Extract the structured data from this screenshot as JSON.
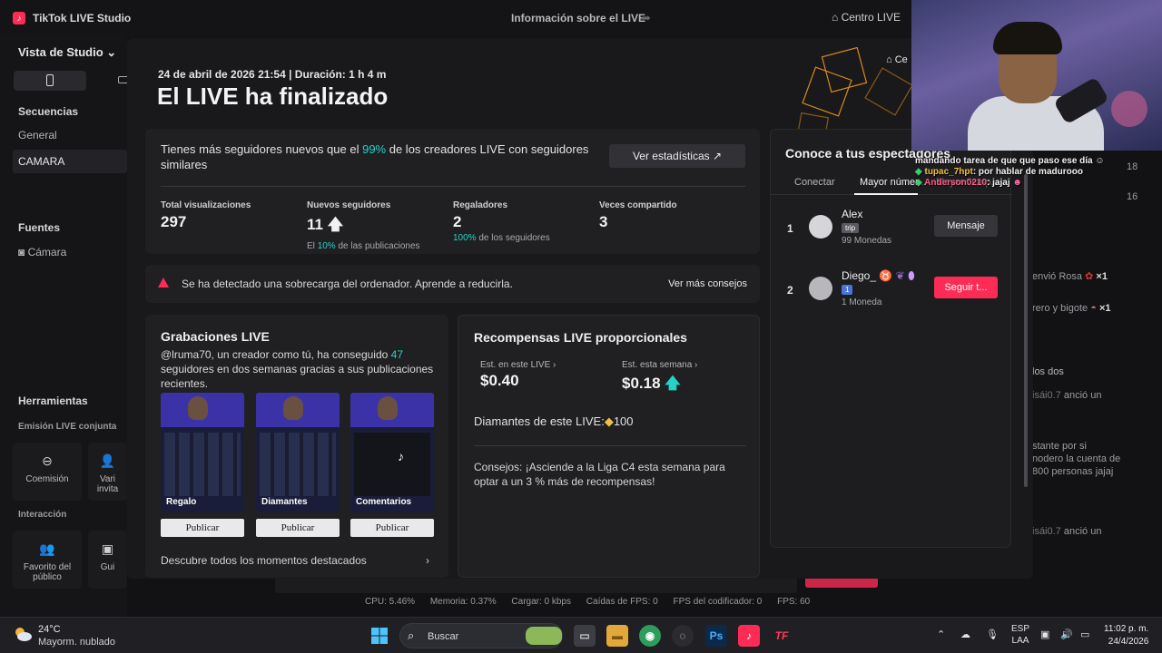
{
  "titlebar": {
    "app_title": "TikTok LIVE Studio",
    "center_title": "Información sobre el LIVE",
    "centro": "Centro LIVE"
  },
  "sidebar": {
    "view_title": "Vista de Studio",
    "sequences_header": "Secuencias",
    "seq_general": "General",
    "seq_camara": "CAMARA",
    "sources_header": "Fuentes",
    "source_camera": "Cámara",
    "tools_header": "Herramientas",
    "joint_header": "Emisión LIVE conjunta",
    "tool_coemision": "Coemisión",
    "tool_varios": "Vari invita",
    "interaction_header": "Interacción",
    "tool_favorito": "Favorito del público",
    "tool_gui": "Gui"
  },
  "modal": {
    "date_line": "24 de abril de 2026 21:54 | Duración: 1 h 4 m",
    "title": "El LIVE ha finalizado",
    "close_partial": "Ce",
    "lead_pre": "Tienes más seguidores nuevos que el ",
    "lead_pct": "99%",
    "lead_post": " de los creadores LIVE con seguidores similares",
    "stats_button": "Ver estadísticas",
    "stats": [
      {
        "label": "Total visualizaciones",
        "value": "297",
        "sub_hl": "",
        "sub": ""
      },
      {
        "label": "Nuevos seguidores",
        "value": "11",
        "sub_hl": "10%",
        "sub": "El",
        "sub_post": " de las publicaciones"
      },
      {
        "label": "Regaladores",
        "value": "2",
        "sub_hl": "100%",
        "sub": "",
        "sub_post": " de los seguidores"
      },
      {
        "label": "Veces compartido",
        "value": "3",
        "sub_hl": "",
        "sub": ""
      }
    ],
    "warning": "Se ha detectado una sobrecarga del ordenador. Aprende a reducirla.",
    "warning_link": "Ver más consejos",
    "recordings": {
      "title": "Grabaciones LIVE",
      "text_pre": "@lruma70, un creador como tú, ha conseguido ",
      "text_num": "47",
      "text_post": " seguidores en dos semanas gracias a sus publicaciones recientes.",
      "thumbs": [
        "Regalo",
        "Diamantes",
        "Comentarios"
      ],
      "publish": "Publicar",
      "more": "Descubre todos los momentos destacados"
    },
    "rewards": {
      "title": "Recompensas LIVE proporcionales",
      "this_live_label": "Est. en este LIVE",
      "this_live_value": "$0.40",
      "this_week_label": "Est. esta semana",
      "this_week_value": "$0.18",
      "diamonds": "Diamantes de este LIVE:",
      "diamonds_value": "100",
      "tip": "Consejos: ¡Asciende a la Liga C4 esta semana para optar a un 3 % más de recompensas!"
    },
    "viewers": {
      "title": "Conoce a tus espectadores",
      "tabs": [
        "Conectar",
        "Mayor númer...",
        "Mayor tiemp..."
      ],
      "list": [
        {
          "rank": "1",
          "name": "Alex",
          "badge": "trip",
          "coins": "99 Monedas",
          "action": "Mensaje"
        },
        {
          "rank": "2",
          "name": "Diego_",
          "badge": "1",
          "coins": "1 Moneda",
          "action": "Seguir t..."
        }
      ]
    }
  },
  "background_right": {
    "n18": "18",
    "n16": "16",
    "gift1": "envió Rosa",
    "gift1_count": "×1",
    "gift2": "rero y bigote",
    "gift2_count": "×1",
    "l1": "los dos",
    "l2a": "isái0.7",
    "l2b": "anció un",
    "l3": "stante por si",
    "l4": "nodero la cuenta de",
    "l5": "800 personas jajaj",
    "l6a": "isái0.7",
    "l6b": "anció un"
  },
  "chat": {
    "line1": "mandando tarea de que que paso ese día",
    "user2": "tupac_7hpt",
    "line2": ": por hablar de madurooo",
    "user3": "Anderson0210",
    "line3": ": jajaj"
  },
  "statusbar": {
    "cpu": "CPU: 5.46%",
    "mem": "Memoria: 0.37%",
    "load": "Cargar: 0 kbps",
    "fps_drop": "Caídas de FPS: 0",
    "fps_enc": "FPS del codificador: 0",
    "fps": "FPS: 60"
  },
  "taskbar": {
    "temp": "24°C",
    "weather": "Mayorm. nublado",
    "search": "Buscar",
    "lang1": "ESP",
    "lang2": "LAA",
    "time": "11:02 p. m.",
    "date": "24/4/2026"
  },
  "colors": {
    "accent_pink": "#fe2c55",
    "teal": "#25d2c7"
  }
}
